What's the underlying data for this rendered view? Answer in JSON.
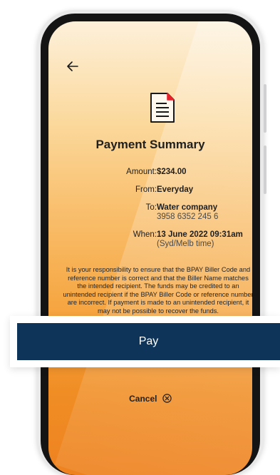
{
  "title": "Payment Summary",
  "summary": {
    "amount_label": "Amount:",
    "amount_value": "$234.00",
    "from_label": "From:",
    "from_value": "Everyday",
    "to_label": "To:",
    "to_name": "Water company",
    "to_number": "3958 6352 245 6",
    "when_label": "When:",
    "when_value": "13 June 2022 09:31am",
    "when_zone": "(Syd/Melb time)"
  },
  "disclaimer": "It is your responsibility to ensure that the BPAY Biller Code and reference number is correct and that the Biller Name matches the intended recipient. The funds may be credited to an unintended recipient if the BPAY Biller Code or reference number are incorrect. If payment is made to an unintended recipient, it may not be possible to recover the funds.",
  "actions": {
    "pay_label": "Pay",
    "cancel_label": "Cancel"
  },
  "icons": {
    "back": "back-arrow-icon",
    "logout": "logout-icon",
    "document": "document-icon",
    "cancel": "close-circle-icon"
  },
  "colors": {
    "pay_button": "#0e3559",
    "accent_red": "#e8202b",
    "background_top": "#fdf0da",
    "background_bottom": "#ee8220"
  }
}
